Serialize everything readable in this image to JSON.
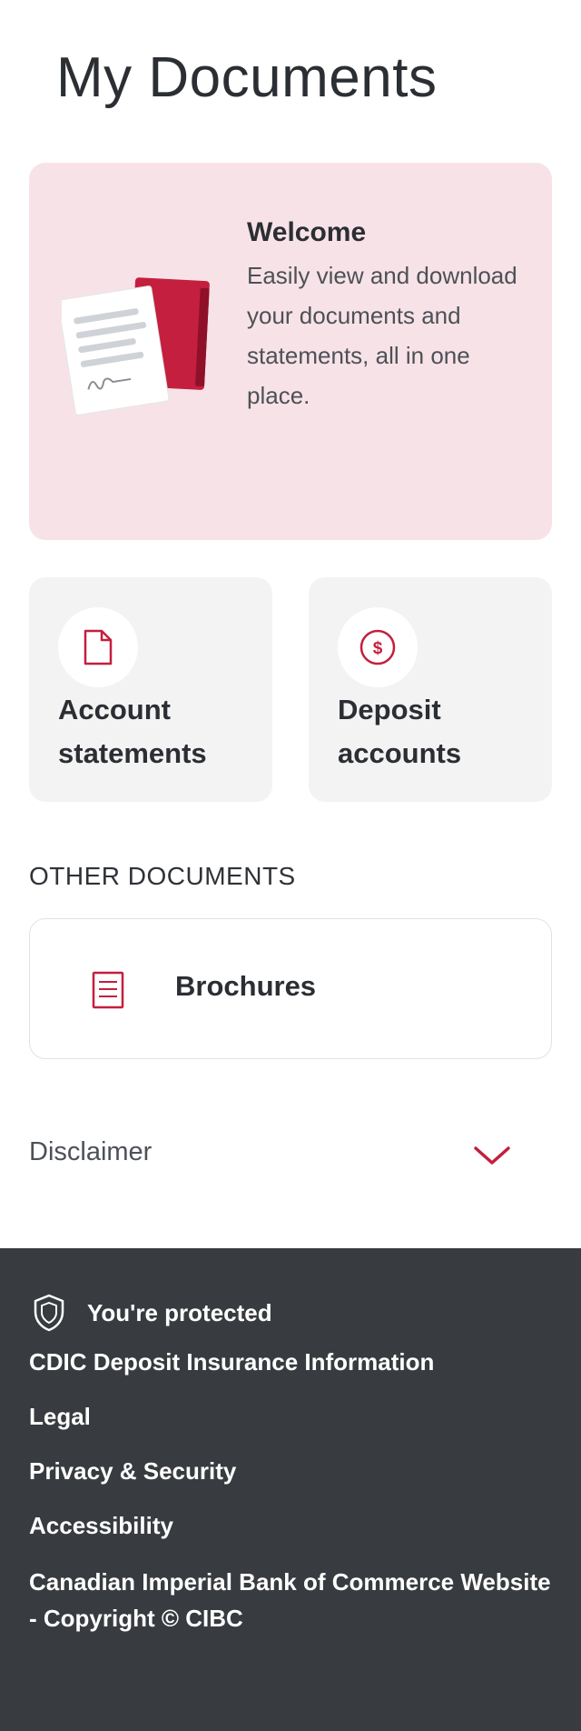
{
  "page": {
    "title": "My Documents"
  },
  "welcome": {
    "heading": "Welcome",
    "body": "Easily view and download your documents and statements, all in one place."
  },
  "tiles": [
    {
      "label": "Account statements",
      "icon": "document-icon"
    },
    {
      "label": "Deposit accounts",
      "icon": "dollar-coin-icon"
    }
  ],
  "other_documents": {
    "heading": "OTHER DOCUMENTS",
    "items": [
      {
        "label": "Brochures",
        "icon": "brochure-icon"
      }
    ]
  },
  "disclaimer": {
    "label": "Disclaimer",
    "icon": "chevron-down-icon"
  },
  "footer": {
    "protected_label": "You're protected",
    "links": [
      "CDIC Deposit Insurance Information",
      "Legal",
      "Privacy & Security",
      "Accessibility"
    ],
    "copyright": "Canadian Imperial Bank of Commerce Website - Copyright © CIBC"
  },
  "colors": {
    "accent": "#c41f3e",
    "welcome_bg": "#f7e3e7",
    "tile_bg": "#f3f3f3",
    "footer_bg": "#383b3f"
  }
}
